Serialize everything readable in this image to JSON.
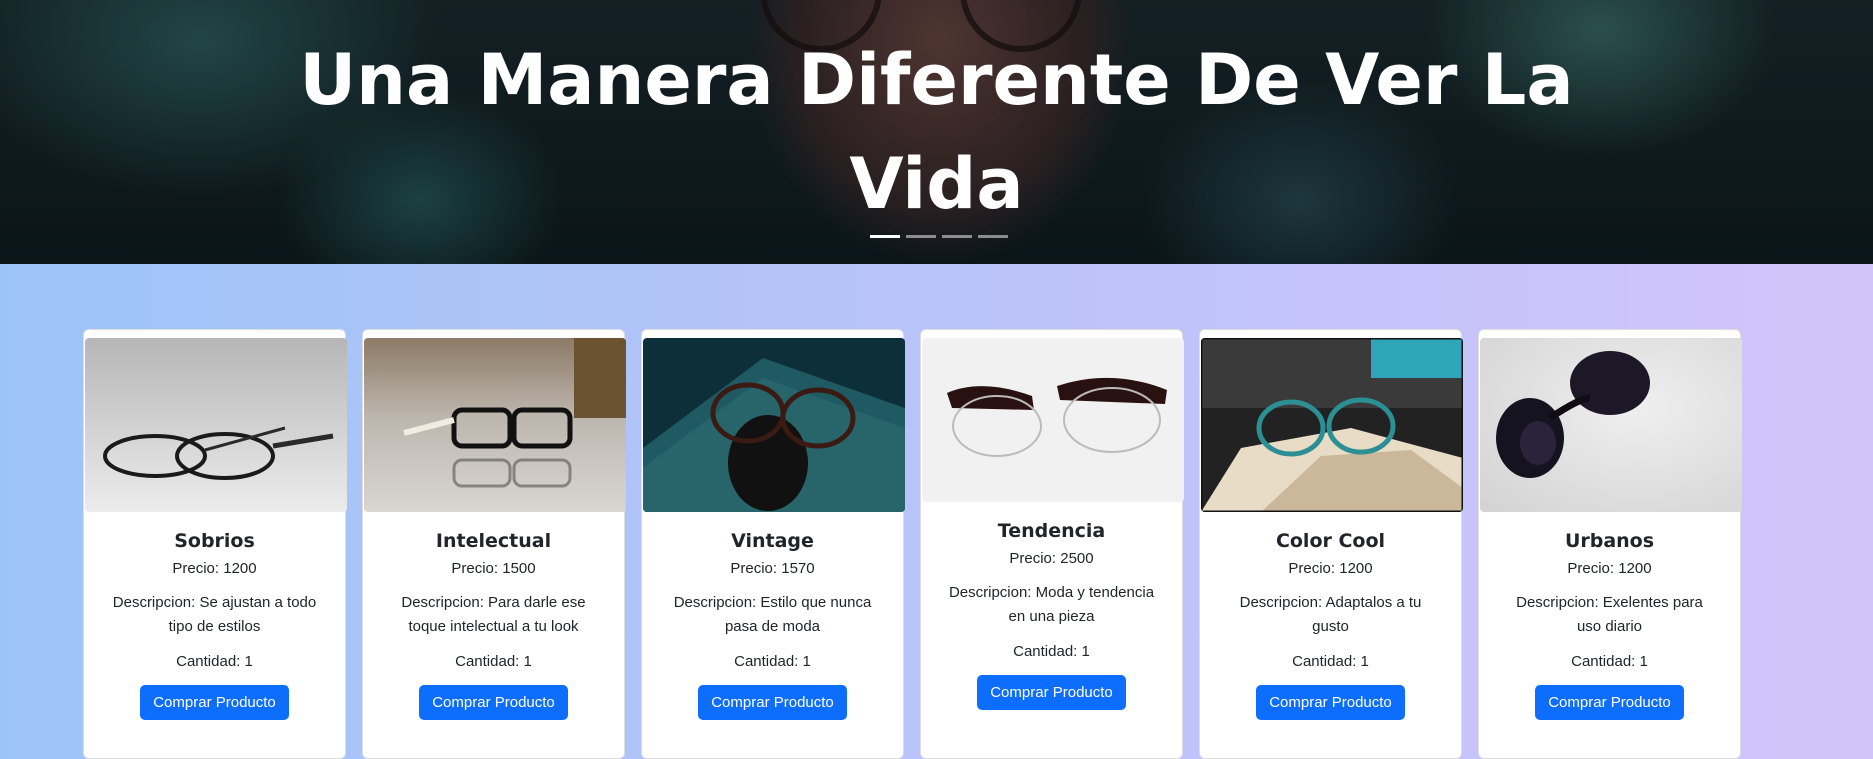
{
  "hero": {
    "title": "Una Manera Diferente De Ver La Vida",
    "slides": 4,
    "active_slide": 1
  },
  "products": [
    {
      "name": "Sobrios",
      "price": "Precio: 1200",
      "description": "Descripcion: Se ajustan a todo tipo de estilos",
      "quantity": "Cantidad: 1",
      "button": "Comprar Producto",
      "image": "black-rimmed-glasses-photo"
    },
    {
      "name": "Intelectual",
      "price": "Precio: 1500",
      "description": "Descripcion: Para darle ese toque intelectual a tu look",
      "quantity": "Cantidad: 1",
      "button": "Comprar Producto",
      "image": "reading-glasses-on-table-photo"
    },
    {
      "name": "Vintage",
      "price": "Precio: 1570",
      "description": "Descripcion: Estilo que nunca pasa de moda",
      "quantity": "Cantidad: 1",
      "button": "Comprar Producto",
      "image": "vintage-glasses-on-book-photo"
    },
    {
      "name": "Tendencia",
      "price": "Precio: 2500",
      "description": "Descripcion: Moda y tendencia en una pieza",
      "quantity": "Cantidad: 1",
      "button": "Comprar Producto",
      "image": "browline-glasses-photo"
    },
    {
      "name": "Color Cool",
      "price": "Precio: 1200",
      "description": "Descripcion: Adaptalos a tu gusto",
      "quantity": "Cantidad: 1",
      "button": "Comprar Producto",
      "image": "teal-glasses-on-book-photo"
    },
    {
      "name": "Urbanos",
      "price": "Precio: 1200",
      "description": "Descripcion: Exelentes para uso diario",
      "quantity": "Cantidad: 1",
      "button": "Comprar Producto",
      "image": "sunglasses-photo"
    }
  ],
  "colors": {
    "button": "#0d6efd",
    "background_start": "#9dc4f8",
    "background_end": "#d2c4fb"
  }
}
